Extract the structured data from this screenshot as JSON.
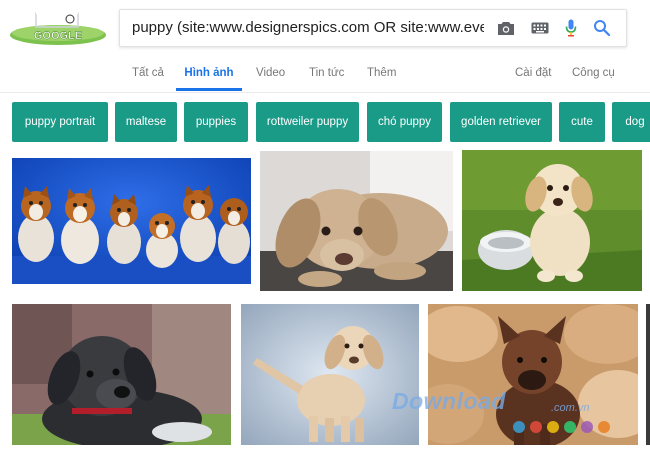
{
  "logo": {
    "text": "GOOGLE"
  },
  "search": {
    "query": "puppy (site:www.designerspics.com OR site:www.everystock"
  },
  "icons": {
    "camera": "camera-icon",
    "keyboard": "keyboard-icon",
    "mic": "mic-icon",
    "search": "search-icon"
  },
  "tabs": [
    {
      "label": "Tất cả"
    },
    {
      "label": "Hình ảnh"
    },
    {
      "label": "Video"
    },
    {
      "label": "Tin tức"
    },
    {
      "label": "Thêm"
    }
  ],
  "tools": {
    "settings": "Cài đặt",
    "tools": "Công cụ"
  },
  "chips": [
    {
      "label": "puppy portrait"
    },
    {
      "label": "maltese"
    },
    {
      "label": "puppies"
    },
    {
      "label": "rottweiler puppy"
    },
    {
      "label": "chó puppy"
    },
    {
      "label": "golden retriever"
    },
    {
      "label": "cute"
    },
    {
      "label": "dog"
    }
  ],
  "colors": {
    "accent": "#1a73e8",
    "chip": "#1a9b88"
  },
  "watermark": {
    "text": "Download",
    "domain": ".com.vn"
  }
}
